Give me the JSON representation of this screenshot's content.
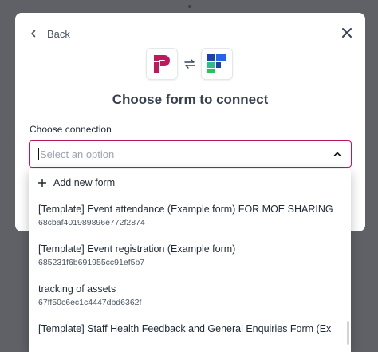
{
  "header": {
    "back_label": "Back"
  },
  "title": "Choose form to connect",
  "connection": {
    "label": "Choose connection",
    "placeholder": "Select an option"
  },
  "dropdown": {
    "add_new_label": "Add new form",
    "options": [
      {
        "name": "[Template] Event attendance (Example form) FOR MOE SHARING",
        "id": "68cbaf401989896e772f2874"
      },
      {
        "name": "[Template] Event registration (Example form)",
        "id": "685231f6b691955cc91ef5b7"
      },
      {
        "name": "tracking of assets",
        "id": "67ff50c6ec1c4447dbd6362f"
      },
      {
        "name": "[Template] Staff Health Feedback and General Enquiries Form (Ex",
        "id": ""
      }
    ]
  },
  "icons": {
    "back": "chevron-left-icon",
    "close": "close-icon",
    "swap": "swap-arrows-icon",
    "add": "plus-icon",
    "select_open": "chevron-up-icon"
  },
  "colors": {
    "accent": "#b6175e",
    "logo_pink": "#c2185b",
    "logo_blue": "#1e40af",
    "logo_green": "#2dbd8c",
    "overlay": "#5f6166"
  }
}
